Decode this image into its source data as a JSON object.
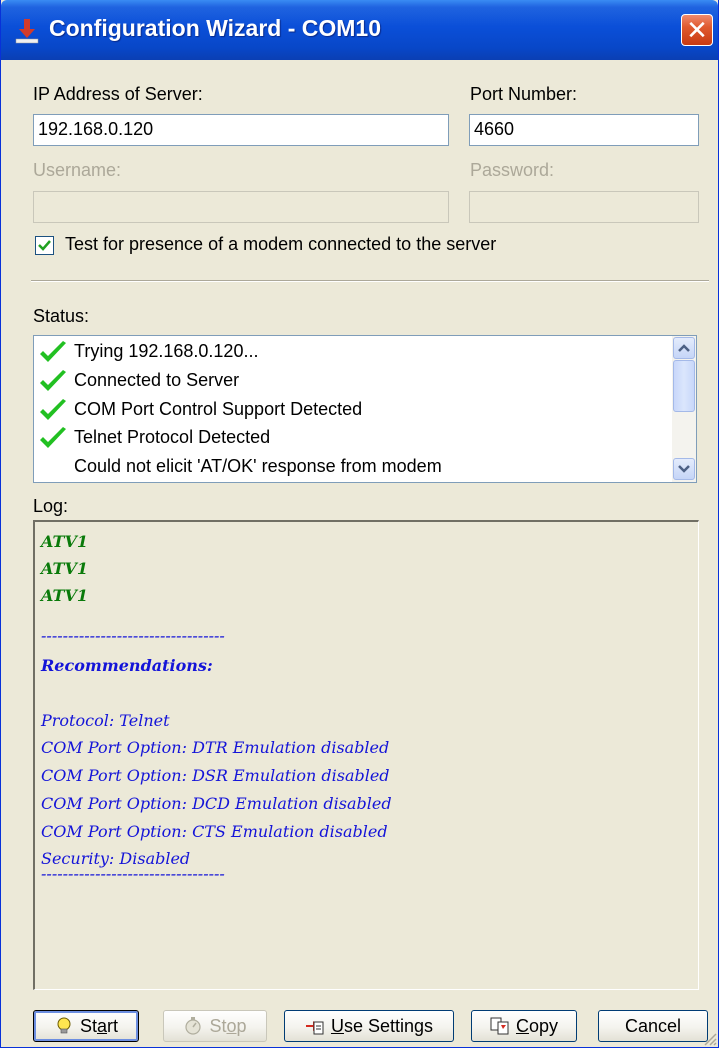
{
  "window": {
    "title": "Configuration Wizard - COM10",
    "close_glyph": "✕"
  },
  "form": {
    "ip_label": "IP Address of Server:",
    "ip_value": "192.168.0.120",
    "port_label": "Port Number:",
    "port_value": "4660",
    "username_label": "Username:",
    "username_value": "",
    "password_label": "Password:",
    "password_value": "",
    "modem_test_label": "Test for presence of a modem connected to the server",
    "modem_test_checked": true
  },
  "status": {
    "label": "Status:",
    "items": [
      {
        "text": "Trying 192.168.0.120...",
        "icon": "green-check-icon"
      },
      {
        "text": "Connected to Server",
        "icon": "green-check-icon"
      },
      {
        "text": "COM Port Control Support Detected",
        "icon": "green-check-icon"
      },
      {
        "text": "Telnet Protocol Detected",
        "icon": "green-check-icon"
      },
      {
        "text": "Could not elicit 'AT/OK' response from modem",
        "icon": ""
      }
    ]
  },
  "log": {
    "label": "Log:",
    "lines": [
      {
        "text": "ATV1",
        "color": "#0a7a0a"
      },
      {
        "text": "ATV1",
        "color": "#0a7a0a"
      },
      {
        "text": "ATV1",
        "color": "#0a7a0a"
      },
      {
        "text": "",
        "color": "#1414d8"
      },
      {
        "text": "----------------------------------",
        "color": "#1414d8"
      },
      {
        "text": "Recommendations:",
        "color": "#1414d8"
      },
      {
        "text": "",
        "color": "#1414d8"
      },
      {
        "text": "Protocol: Telnet",
        "color": "#1414d8"
      },
      {
        "text": "COM Port Option: DTR Emulation disabled",
        "color": "#1414d8"
      },
      {
        "text": "COM Port Option: DSR Emulation disabled",
        "color": "#1414d8"
      },
      {
        "text": "COM Port Option: DCD Emulation disabled",
        "color": "#1414d8"
      },
      {
        "text": "COM Port Option: CTS Emulation disabled",
        "color": "#1414d8"
      },
      {
        "text": "Security: Disabled",
        "color": "#1414d8"
      },
      {
        "text": "----------------------------------",
        "color": "#1414d8"
      }
    ]
  },
  "buttons": {
    "start_pre": "St",
    "start_u": "a",
    "start_post": "rt",
    "stop_pre": "St",
    "stop_u": "o",
    "stop_post": "p",
    "use_settings_u": "U",
    "use_settings_post": "se Settings",
    "copy_u": "C",
    "copy_post": "opy",
    "cancel": "Cancel"
  }
}
